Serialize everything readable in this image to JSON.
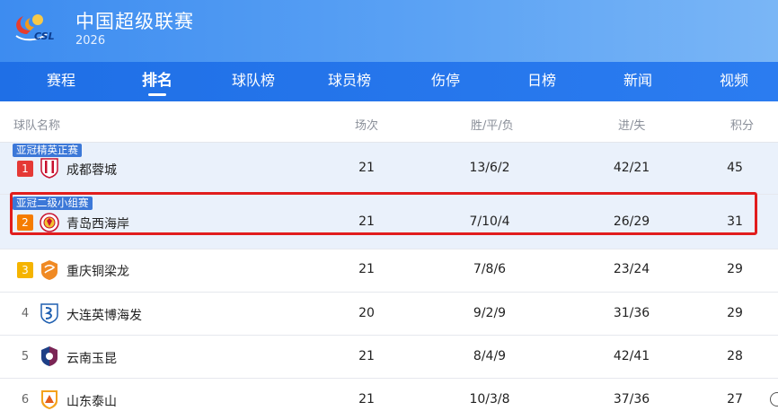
{
  "header": {
    "logo_text": "CSL",
    "title": "中国超级联赛",
    "year": "2026"
  },
  "tabs": [
    {
      "label": "赛程",
      "active": false
    },
    {
      "label": "排名",
      "active": true
    },
    {
      "label": "球队榜",
      "active": false
    },
    {
      "label": "球员榜",
      "active": false
    },
    {
      "label": "伤停",
      "active": false
    },
    {
      "label": "日榜",
      "active": false
    },
    {
      "label": "新闻",
      "active": false
    },
    {
      "label": "视频",
      "active": false
    }
  ],
  "columns": {
    "team": "球队名称",
    "played": "场次",
    "record": "胜/平/负",
    "goals": "进/失",
    "points": "积分"
  },
  "rows": [
    {
      "rank": "1",
      "rank_color": "#e53935",
      "tag": "亚冠精英正赛",
      "team": "成都蓉城",
      "played": "21",
      "record": "13/6/2",
      "goals": "42/21",
      "points": "45",
      "highlight": true
    },
    {
      "rank": "2",
      "rank_color": "#f57c00",
      "tag": "亚冠二级小组赛",
      "team": "青岛西海岸",
      "played": "21",
      "record": "7/10/4",
      "goals": "26/29",
      "points": "31",
      "highlight": true
    },
    {
      "rank": "3",
      "rank_color": "#f5b400",
      "tag": "",
      "team": "重庆铜梁龙",
      "played": "21",
      "record": "7/8/6",
      "goals": "23/24",
      "points": "29",
      "highlight": false
    },
    {
      "rank": "4",
      "rank_color": "",
      "tag": "",
      "team": "大连英博海发",
      "played": "20",
      "record": "9/2/9",
      "goals": "31/36",
      "points": "29",
      "highlight": false
    },
    {
      "rank": "5",
      "rank_color": "",
      "tag": "",
      "team": "云南玉昆",
      "played": "21",
      "record": "8/4/9",
      "goals": "42/41",
      "points": "28",
      "highlight": false
    },
    {
      "rank": "6",
      "rank_color": "",
      "tag": "",
      "team": "山东泰山",
      "played": "21",
      "record": "10/3/8",
      "goals": "37/36",
      "points": "27",
      "highlight": false
    }
  ],
  "crest_icons": [
    "chengdu-crest-icon",
    "qingdao-crest-icon",
    "chongqing-crest-icon",
    "dalian-crest-icon",
    "yunnan-crest-icon",
    "shandong-crest-icon"
  ],
  "colors": {
    "header_blue": "#4a94f2",
    "tab_blue": "#2475ec",
    "highlight_row": "#eaf1fb",
    "tag_blue": "#3c78d8",
    "annotation_red": "#e11d1d"
  }
}
